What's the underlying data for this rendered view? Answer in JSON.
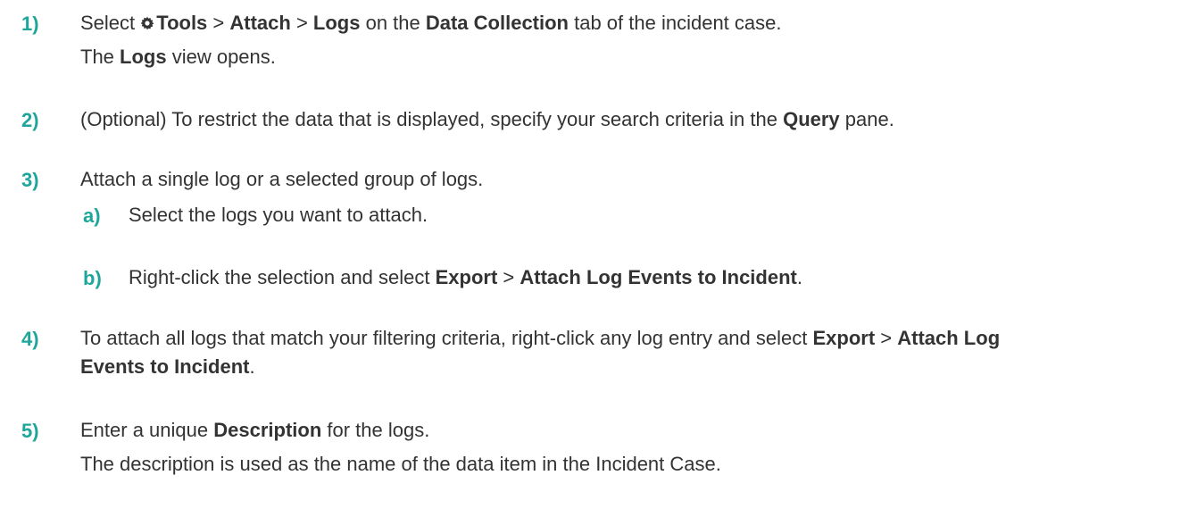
{
  "steps": [
    {
      "number": "1)",
      "line1": {
        "t1": "Select ",
        "tools": "Tools",
        "sep1": " > ",
        "attach": "Attach",
        "sep2": " > ",
        "logs": "Logs",
        "t2": " on the ",
        "data_collection": "Data Collection",
        "t3": " tab of the incident case."
      },
      "line2": {
        "t1": "The ",
        "logs": "Logs",
        "t2": " view opens."
      }
    },
    {
      "number": "2)",
      "line1": {
        "t1": "(Optional) To restrict the data that is displayed, specify your search criteria in the ",
        "query": "Query",
        "t2": " pane."
      }
    },
    {
      "number": "3)",
      "line1": "Attach a single log or a selected group of logs.",
      "substeps": [
        {
          "letter": "a)",
          "text": "Select the logs you want to attach."
        },
        {
          "letter": "b)",
          "t1": "Right-click the selection and select ",
          "export": "Export",
          "sep": " > ",
          "attach_events": "Attach Log Events to Incident",
          "t2": "."
        }
      ]
    },
    {
      "number": "4)",
      "line1": {
        "t1": "To attach all logs that match your filtering criteria, right-click any log entry and select ",
        "export": "Export",
        "sep": " > ",
        "attach_log": "Attach Log"
      },
      "line2": {
        "events": "Events to Incident",
        "t2": "."
      }
    },
    {
      "number": "5)",
      "line1": {
        "t1": "Enter a unique ",
        "description": "Description",
        "t2": " for the logs."
      },
      "line2": "The description is used as the name of the data item in the Incident Case."
    }
  ],
  "colors": {
    "accent": "#1fa69a",
    "text": "#333333"
  },
  "icons": {
    "tools": "gear-icon"
  }
}
